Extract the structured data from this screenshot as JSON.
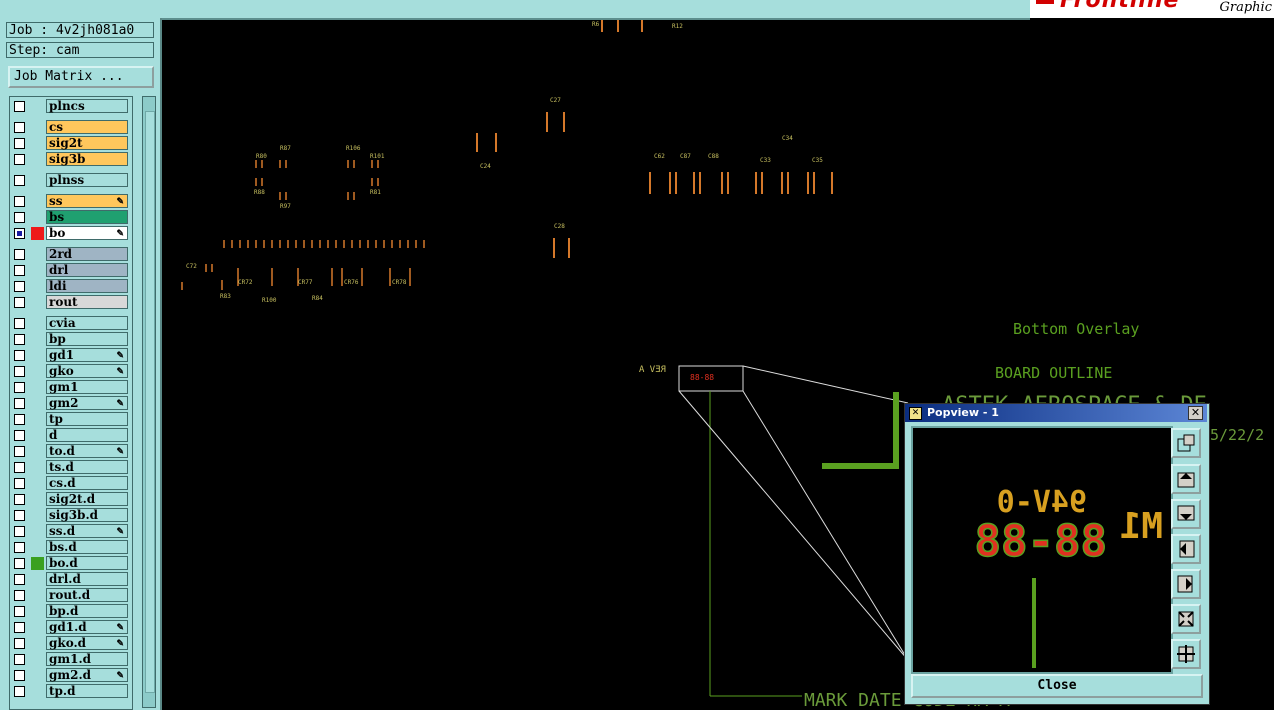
{
  "app": {
    "logo_text": "Frontline",
    "logo_sub": "Graphic"
  },
  "info": {
    "job": "Job : 4v2jh081a0",
    "step": "Step: cam"
  },
  "buttons": {
    "job_matrix": "Job Matrix ..."
  },
  "layers": [
    {
      "name": "plncs",
      "color": "#a6dedc",
      "checked": false,
      "pencil": false
    },
    {
      "name": "cs",
      "color": "#ffc75c",
      "checked": false,
      "pencil": false
    },
    {
      "name": "sig2t",
      "color": "#ffc75c",
      "checked": false,
      "pencil": false
    },
    {
      "name": "sig3b",
      "color": "#ffc75c",
      "checked": false,
      "pencil": false
    },
    {
      "name": "plnss",
      "color": "#a6dedc",
      "checked": false,
      "pencil": false
    },
    {
      "name": "ss",
      "color": "#ffc75c",
      "checked": false,
      "pencil": true
    },
    {
      "name": "bs",
      "color": "#1fa070",
      "checked": false,
      "pencil": false
    },
    {
      "name": "bo",
      "color": "#ffffff",
      "checked": true,
      "pencil": true,
      "swatch": "#ee1a1a"
    },
    {
      "name": "2rd",
      "color": "#9fb4c4",
      "checked": false,
      "pencil": false
    },
    {
      "name": "drl",
      "color": "#9fb4c4",
      "checked": false,
      "pencil": false
    },
    {
      "name": "ldi",
      "color": "#9fb4c4",
      "checked": false,
      "pencil": false
    },
    {
      "name": "rout",
      "color": "#d8d8d8",
      "checked": false,
      "pencil": false
    },
    {
      "name": "cvia",
      "color": "#a6dedc",
      "checked": false,
      "pencil": false
    },
    {
      "name": "bp",
      "color": "#a6dedc",
      "checked": false,
      "pencil": false
    },
    {
      "name": "gd1",
      "color": "#a6dedc",
      "checked": false,
      "pencil": true
    },
    {
      "name": "gko",
      "color": "#a6dedc",
      "checked": false,
      "pencil": true
    },
    {
      "name": "gm1",
      "color": "#a6dedc",
      "checked": false,
      "pencil": false
    },
    {
      "name": "gm2",
      "color": "#a6dedc",
      "checked": false,
      "pencil": true
    },
    {
      "name": "tp",
      "color": "#a6dedc",
      "checked": false,
      "pencil": false
    },
    {
      "name": "d",
      "color": "#a6dedc",
      "checked": false,
      "pencil": false
    },
    {
      "name": "to.d",
      "color": "#a6dedc",
      "checked": false,
      "pencil": true
    },
    {
      "name": "ts.d",
      "color": "#a6dedc",
      "checked": false,
      "pencil": false
    },
    {
      "name": "cs.d",
      "color": "#a6dedc",
      "checked": false,
      "pencil": false
    },
    {
      "name": "sig2t.d",
      "color": "#a6dedc",
      "checked": false,
      "pencil": false
    },
    {
      "name": "sig3b.d",
      "color": "#a6dedc",
      "checked": false,
      "pencil": false
    },
    {
      "name": "ss.d",
      "color": "#a6dedc",
      "checked": false,
      "pencil": true
    },
    {
      "name": "bs.d",
      "color": "#a6dedc",
      "checked": false,
      "pencil": false
    },
    {
      "name": "bo.d",
      "color": "#a6dedc",
      "checked": false,
      "pencil": false,
      "swatch": "#3aa020"
    },
    {
      "name": "drl.d",
      "color": "#a6dedc",
      "checked": false,
      "pencil": false
    },
    {
      "name": "rout.d",
      "color": "#a6dedc",
      "checked": false,
      "pencil": false
    },
    {
      "name": "bp.d",
      "color": "#a6dedc",
      "checked": false,
      "pencil": false
    },
    {
      "name": "gd1.d",
      "color": "#a6dedc",
      "checked": false,
      "pencil": true
    },
    {
      "name": "gko.d",
      "color": "#a6dedc",
      "checked": false,
      "pencil": true
    },
    {
      "name": "gm1.d",
      "color": "#a6dedc",
      "checked": false,
      "pencil": false
    },
    {
      "name": "gm2.d",
      "color": "#a6dedc",
      "checked": false,
      "pencil": true
    },
    {
      "name": "tp.d",
      "color": "#a6dedc",
      "checked": false,
      "pencil": false
    }
  ],
  "canvas": {
    "text_bottom_overlay": "Bottom Overlay",
    "text_board_outline": "BOARD OUTLINE",
    "text_company": "ASTEK AEROSPACE & DE",
    "text_date": "5/22/2",
    "text_mark": "MARK DATE CODE HA-A",
    "text_rev": "REV A",
    "colors": {
      "orange": "#d4782a",
      "green": "#5aa020",
      "outline": "#6a9a3a",
      "red": "#e03020",
      "label": "#c8c060"
    }
  },
  "popview": {
    "title": "Popview - 1",
    "close_x": "✕",
    "close_button": "Close",
    "zoom_text_top": "94V-0",
    "zoom_text_mid": "88-88",
    "zoom_text_side": "M1"
  }
}
